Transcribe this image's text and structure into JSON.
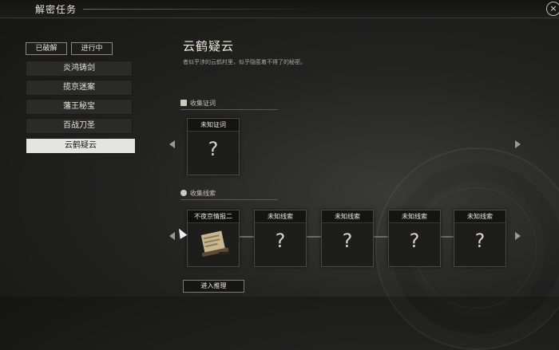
{
  "header": {
    "title": "解密任务",
    "close_icon": "×"
  },
  "filters": [
    {
      "label": "已破解",
      "selected": false
    },
    {
      "label": "进行中",
      "selected": true
    }
  ],
  "quests": [
    {
      "label": "炎鸿铸剑",
      "active": false
    },
    {
      "label": "揽京迷案",
      "active": false
    },
    {
      "label": "藩王秘宝",
      "active": false
    },
    {
      "label": "百战刀圣",
      "active": false
    },
    {
      "label": "云鹤疑云",
      "active": true
    }
  ],
  "detail": {
    "title": "云鹤疑云",
    "description": "者似乎涉的云鹤村里，似乎隐匿着不得了的秘密。",
    "testimony_section": "收集证词",
    "clue_section": "收集线索",
    "testimony_cards": [
      {
        "label": "未知证词",
        "mark": "?"
      }
    ],
    "clue_cards": [
      {
        "label": "不夜京情报二",
        "mark": "",
        "found": true
      },
      {
        "label": "未知线索",
        "mark": "?",
        "found": false
      },
      {
        "label": "未知线索",
        "mark": "?",
        "found": false
      },
      {
        "label": "未知线索",
        "mark": "?",
        "found": false
      },
      {
        "label": "未知线索",
        "mark": "?",
        "found": false
      }
    ],
    "deduce_button": "进入推理"
  },
  "icons": {
    "testimony": "scroll-icon",
    "clue": "magnifier-icon",
    "found_clue": "scroll-document-icon",
    "prev": "arrow-left-icon",
    "next": "arrow-right-icon"
  }
}
